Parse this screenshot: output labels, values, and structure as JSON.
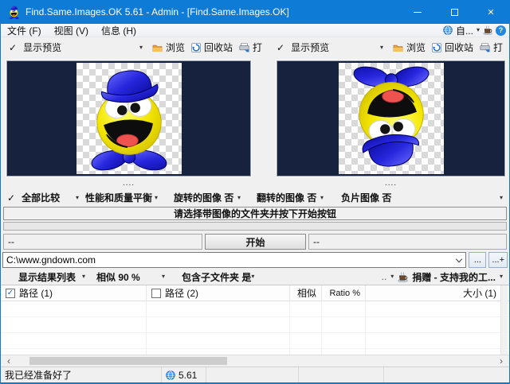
{
  "titlebar": {
    "title": "Find.Same.Images.OK 5.61 - Admin - [Find.Same.Images.OK]"
  },
  "menubar": {
    "file": "文件 (F)",
    "view": "视图 (V)",
    "info": "信息 (H)",
    "auto_label": "自...",
    "help_label": "?"
  },
  "panes": {
    "left": {
      "preview_label": "显示预览",
      "browse_label": "浏览",
      "recycle_label": "回收站",
      "print_label": "打",
      "caption": "...."
    },
    "right": {
      "preview_label": "显示预览",
      "browse_label": "浏览",
      "recycle_label": "回收站",
      "print_label": "打",
      "caption": "...."
    }
  },
  "options": {
    "compare_all": "全部比较",
    "quality": "性能和质量平衡",
    "rotated": "旋转的图像 否",
    "flipped": "翻转的图像 否",
    "negative": "负片图像 否"
  },
  "banner_label": "请选择带图像的文件夹并按下开始按钮",
  "start_row": {
    "left_value": "--",
    "start_label": "开始",
    "right_value": "--"
  },
  "path_row": {
    "value": "C:\\www.gndown.com",
    "browse_label": "...",
    "browse_plus_label": "...+"
  },
  "results_bar": {
    "show_results": "显示结果列表",
    "similarity": "相似 90 %",
    "subfolders": "包含子文件夹 是",
    "more_label": "..",
    "donate_label": "捐赠 - 支持我的工..."
  },
  "table": {
    "col_path1": "路径 (1)",
    "col_path2": "路径 (2)",
    "col_similar": "相似",
    "col_ratio": "Ratio %",
    "col_size": "大小 (1)"
  },
  "statusbar": {
    "ready": "我已经准备好了",
    "version": "5.61"
  },
  "icons": {
    "dropdown": "▾",
    "check": "✓",
    "checkbox_check": "✓",
    "scroll_left": "‹",
    "scroll_right": "›",
    "close": "×"
  },
  "colors": {
    "titlebar": "#0e7cd7",
    "preview_bg": "#17223f",
    "accent": "#0e7ad2"
  }
}
